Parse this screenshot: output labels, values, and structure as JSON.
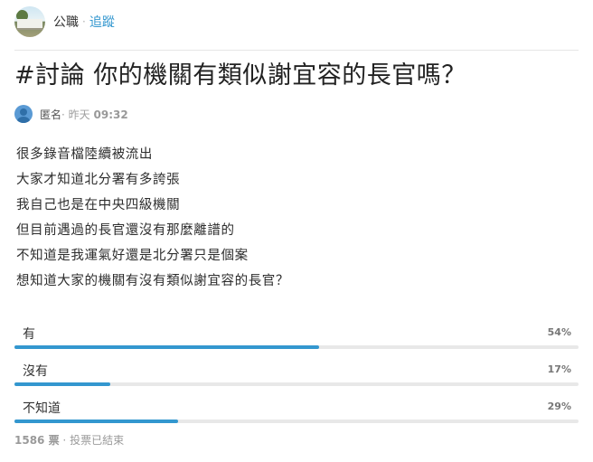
{
  "header": {
    "board_name": "公職",
    "separator": "·",
    "follow_label": "追蹤"
  },
  "post": {
    "title": "#討論 你的機關有類似謝宜容的長官嗎？",
    "author": {
      "name": "匿名",
      "separator": "·",
      "date": "昨天",
      "time": "09:32",
      "avatar_icon": "anonymous-user-icon"
    },
    "content_lines": [
      "很多錄音檔陸續被流出",
      "大家才知道北分署有多誇張",
      "我自己也是在中央四級機關",
      "但目前遇過的長官還沒有那麼離譜的",
      "不知道是我運氣好還是北分署只是個案",
      "想知道大家的機關有沒有類似謝宜容的長官？"
    ]
  },
  "poll": {
    "options": [
      {
        "label": "有",
        "percent_text": "54%",
        "percent": 54
      },
      {
        "label": "沒有",
        "percent_text": "17%",
        "percent": 17
      },
      {
        "label": "不知道",
        "percent_text": "29%",
        "percent": 29
      }
    ],
    "votes": "1586 票",
    "separator": "·",
    "status": "投票已結束"
  },
  "colors": {
    "accent": "#3397cf",
    "track": "#e8e8e8",
    "text": "#333333",
    "muted": "#9a9a9a"
  }
}
